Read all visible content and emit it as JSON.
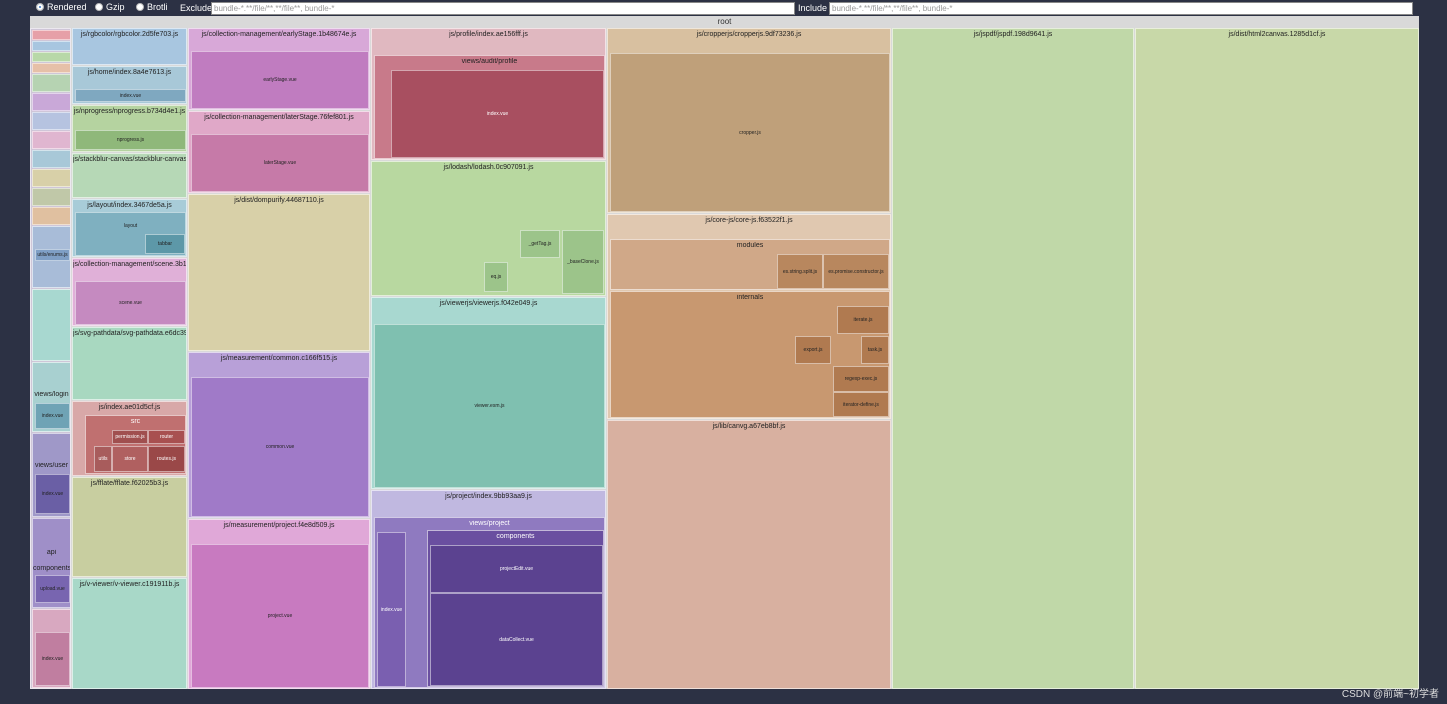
{
  "toolbar": {
    "size_options": [
      "Rendered",
      "Gzip",
      "Brotli"
    ],
    "selected": "Rendered",
    "exclude_label": "Exclude",
    "exclude_placeholder": "bundle-*.**/file/**,**/file**, bundle-*",
    "include_label": "Include",
    "include_placeholder": "bundle-*.**/file/**,**/file**, bundle-*"
  },
  "root_label": "root",
  "chunks": {
    "rgbcolor": "js/rgbcolor/rgbcolor.2d5fe703.js",
    "home": "js/home/index.8a4e7613.js",
    "home_index": "index.vue",
    "nprogress": "js/nprogress/nprogress.b734d4e1.js",
    "nprogress_file": "nprogress.js",
    "stackblur": "js/stackblur-canvas/stackblur-canvas.876442ad.js",
    "layout": "js/layout/index.3467de5a.js",
    "layout_dir": "layout",
    "tabbar": "tabbar",
    "scene": "js/collection-management/scene.3b162a39.js",
    "scene_file": "scene.vue",
    "svgpath": "js/svg-pathdata/svg-pathdata.e6dc3915.js",
    "index_ae": "js/index.ae01d5cf.js",
    "src": "src",
    "permission": "permission.js",
    "router": "router",
    "utils": "utils",
    "store": "store",
    "routes": "routes.js",
    "fflate": "js/fflate/fflate.f62025b3.js",
    "vviewer": "js/v-viewer/v-viewer.c191911b.js",
    "early": "js/collection-management/earlyStage.1b48674e.js",
    "early_file": "earlyStage.vue",
    "later": "js/collection-management/laterStage.76fef801.js",
    "later_file": "laterStage.vue",
    "dompurify": "js/dist/dompurify.44687110.js",
    "common": "js/measurement/common.c166f515.js",
    "common_file": "common.vue",
    "project_m": "js/measurement/project.f4e8d509.js",
    "project_m_file": "project.vue",
    "profile": "js/profile/index.ae156fff.js",
    "audit": "views/audit/profile",
    "profile_index": "index.vue",
    "lodash": "js/lodash/lodash.0c907091.js",
    "gettag": "_getTag.js",
    "baseclone": "_baseClone.js",
    "eq": "eq.js",
    "viewerjs": "js/viewerjs/viewerjs.f042e049.js",
    "viewer_esm": "viewer.esm.js",
    "project": "js/project/index.9bb93aa9.js",
    "views_project": "views/project",
    "components": "components",
    "project_edit": "projectEdit.vue",
    "data_collect": "dataCollect.vue",
    "project_index": "index.vue",
    "cropperjs": "js/cropperjs/cropperjs.9df73236.js",
    "cropper": "cropper.js",
    "corejs": "js/core-js/core-js.f63522f1.js",
    "modules": "modules",
    "es_split": "es.string.split.js",
    "es_promise": "es.promise.constructor.js",
    "internals": "internals",
    "export": "export.js",
    "task": "task.js",
    "iterate": "iterate.js",
    "regexp": "regexp-exec.js",
    "iter_define": "iterator-define.js",
    "canvg": "js/lib/canvg.a67eb8bf.js",
    "jspdf": "js/jspdf/jspdf.198d9641.js",
    "html2canvas": "js/dist/html2canvas.1285d1cf.js",
    "left_utils": "utils/enums.js",
    "views_login": "views/login",
    "left_index": "index.vue",
    "views_user": "views/user",
    "api": "api",
    "components2": "components",
    "upload": "upload.vue"
  },
  "watermark": "CSDN @前端~初学者",
  "colors": {
    "background": "#2c3144",
    "root": "#d9d9d9"
  }
}
